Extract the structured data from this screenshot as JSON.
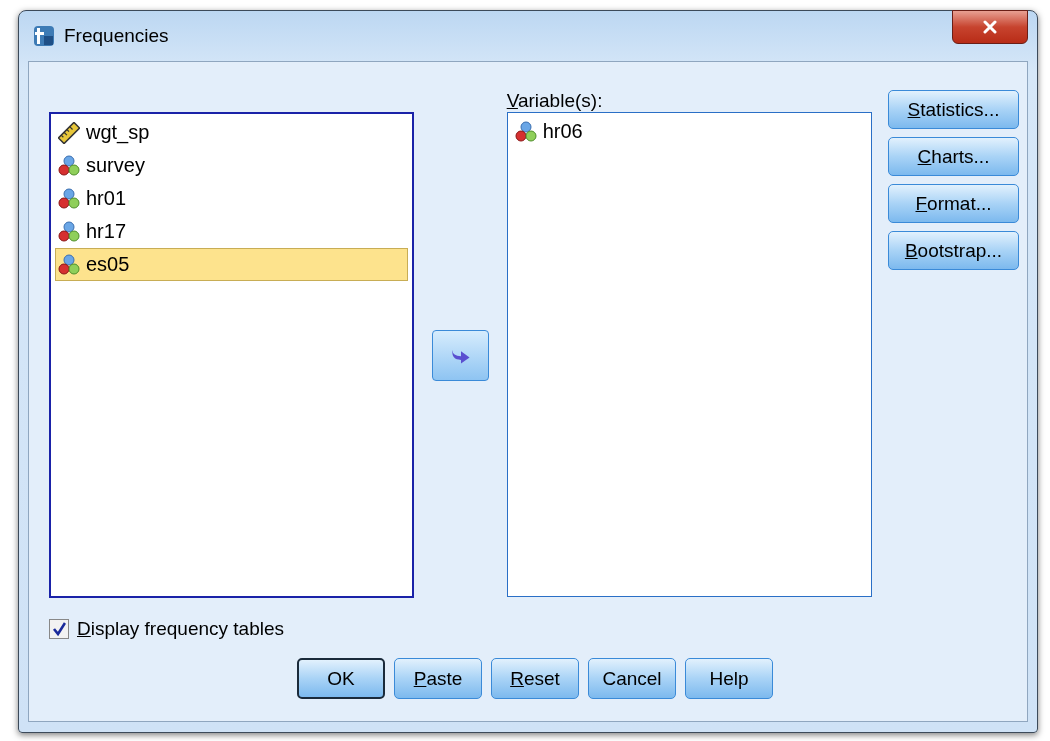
{
  "window": {
    "title": "Frequencies"
  },
  "source_list": {
    "items": [
      {
        "name": "wgt_sp",
        "kind": "scale",
        "selected": false
      },
      {
        "name": "survey",
        "kind": "nominal",
        "selected": false
      },
      {
        "name": "hr01",
        "kind": "nominal",
        "selected": false
      },
      {
        "name": "hr17",
        "kind": "nominal",
        "selected": false
      },
      {
        "name": "es05",
        "kind": "nominal",
        "selected": true
      }
    ]
  },
  "target_list": {
    "label": "Variable(s):",
    "label_mnemonic": true,
    "items": [
      {
        "name": "hr06",
        "kind": "nominal",
        "selected": false
      }
    ]
  },
  "side_buttons": [
    {
      "label": "Statistics...",
      "mnemonic": true
    },
    {
      "label": "Charts...",
      "mnemonic": true
    },
    {
      "label": "Format...",
      "mnemonic": true
    },
    {
      "label": "Bootstrap...",
      "mnemonic": true
    }
  ],
  "checkbox": {
    "label": "Display frequency tables",
    "mnemonic": true,
    "checked": true
  },
  "buttons": [
    {
      "label": "OK",
      "mnemonic": false,
      "default": true
    },
    {
      "label": "Paste",
      "mnemonic": true,
      "default": false
    },
    {
      "label": "Reset",
      "mnemonic": true,
      "default": false
    },
    {
      "label": "Cancel",
      "mnemonic": false,
      "default": false
    },
    {
      "label": "Help",
      "mnemonic": false,
      "default": false
    }
  ]
}
